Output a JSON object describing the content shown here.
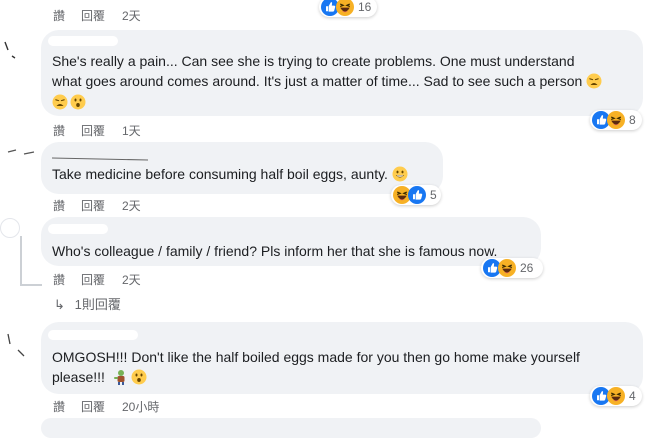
{
  "action_labels": {
    "like": "讚",
    "reply": "回覆"
  },
  "comments": [
    {
      "time": "2天",
      "reaction_count": "16"
    },
    {
      "text_line1": "She's really a pain... Can see she is trying to create problems. One must understand",
      "text_line2": "what goes around comes around. It's just a matter of time... Sad to see such a person",
      "time": "1天",
      "reaction_count": "8"
    },
    {
      "text": "Take medicine before consuming half boil eggs, aunty.",
      "time": "2天",
      "reaction_count": "5"
    },
    {
      "text": "Who's colleague / family / friend? Pls inform her that she is famous now.",
      "time": "2天",
      "reaction_count": "26",
      "replies_label": "1則回覆"
    },
    {
      "text_line1": "OMGOSH!!! Don't like the half boiled eggs made for you then go home make yourself",
      "text_line2": "please!!!",
      "time": "20小時",
      "reaction_count": "4"
    }
  ],
  "icons": {
    "like": "thumbs-up-icon",
    "haha": "laughing-face-icon",
    "reply_arrow": "reply-arrow-icon",
    "emoji_grin": "grinning-face-emoji",
    "emoji_tired": "tired-face-emoji",
    "emoji_surprised": "surprised-face-emoji",
    "emoji_zombie": "zombie-emoji"
  },
  "colors": {
    "like_blue": "#1877f2",
    "haha_yellow": "#f7b125",
    "bubble_bg": "#f0f2f5",
    "muted_text": "#65676b"
  }
}
